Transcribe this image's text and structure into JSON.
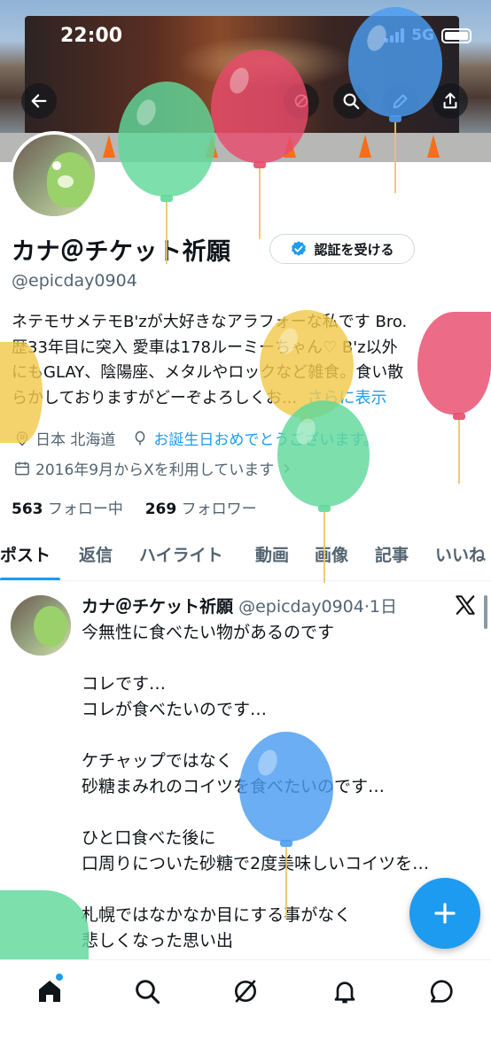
{
  "status_bar": {
    "time": "22:00",
    "network": "5G"
  },
  "profile": {
    "name": "カナ＠チケット祈願",
    "verify_label": "認証を受ける",
    "handle": "@epicday0904",
    "bio_lines": [
      "ネテモサメテモB'zが大好きなアラフォーな私です Bro.",
      "歴33年目に突入 愛車は178ルーミーちゃん♡ B'z以外",
      "にもGLAY、陰陽座、メタルやロックなど雑食。食い散",
      "らかしておりますがどーぞよろしくお..."
    ],
    "bio_more": "さらに表示",
    "location": "日本 北海道",
    "birthday_link": "お誕生日おめでとうございます。",
    "joined": "2016年9月からXを利用しています",
    "following_count": "563",
    "following_label": "フォロー中",
    "followers_count": "269",
    "followers_label": "フォロワー"
  },
  "tabs": [
    "ポスト",
    "返信",
    "ハイライト",
    "動画",
    "画像",
    "記事",
    "いいね"
  ],
  "active_tab": "ポスト",
  "post": {
    "author_name": "カナ＠チケット祈願",
    "author_handle": "@epicday0904",
    "time": "·1日",
    "lines": [
      "今無性に食べたい物があるのです",
      "",
      "コレです…",
      "コレが食べたいのです…",
      "",
      "ケチャップではなく",
      "砂糖まみれのコイツを食べたいのです…",
      "",
      "ひと口食べた後に",
      "口周りについた砂糖で2度美味しいコイツを…",
      "",
      "札幌ではなかなか目にする事がなく",
      "悲しくなった思い出"
    ]
  },
  "icons": {
    "header": [
      "back-arrow-icon",
      "grok-icon",
      "search-icon",
      "pen-icon",
      "share-icon"
    ],
    "bottom_nav": [
      "home-icon",
      "search-icon",
      "grok-icon",
      "bell-icon",
      "messages-icon"
    ],
    "fab": "plus-icon"
  },
  "colors": {
    "accent": "#1d9bf0",
    "text": "#0f1419",
    "muted": "#536471",
    "balloon_green": "#5fd89a",
    "balloon_red": "#e84a6b",
    "balloon_blue": "#4b9cf0",
    "balloon_yellow": "#f2c94c"
  }
}
